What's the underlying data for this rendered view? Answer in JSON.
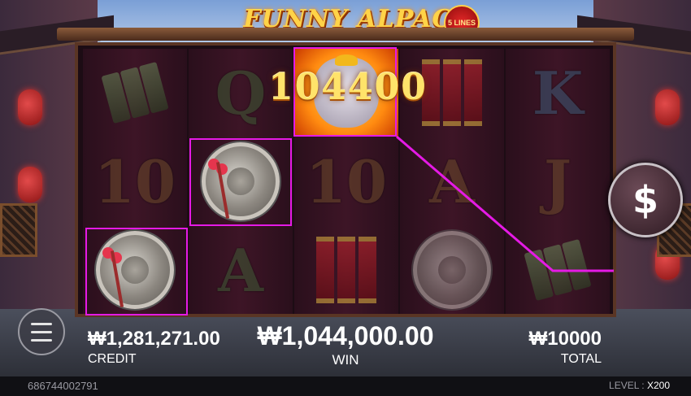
{
  "game": {
    "title": "FUNNY ALPACA",
    "lines_badge": "5 LINES"
  },
  "reels": {
    "symbols": [
      [
        "cymbals",
        "10",
        "gong"
      ],
      [
        "Q",
        "gong",
        "A"
      ],
      [
        "alpaca",
        "10",
        "firecrackers"
      ],
      [
        "firecrackers",
        "A",
        "gong"
      ],
      [
        "K",
        "J",
        "cymbals"
      ]
    ],
    "big_win_amount": "104400"
  },
  "hud": {
    "credit_value": "₩1,281,271.00",
    "credit_label": "CREDIT",
    "win_value": "₩1,044,000.00",
    "win_label": "WIN",
    "total_value": "₩10000",
    "total_label": "TOTAL"
  },
  "footer": {
    "session_id": "686744002791",
    "level_label": "LEVEL :",
    "level_value": "X200"
  },
  "buttons": {
    "spin_icon": "$"
  },
  "colors": {
    "highlight": "#e51ae5",
    "win_text": "#ffe36a"
  }
}
